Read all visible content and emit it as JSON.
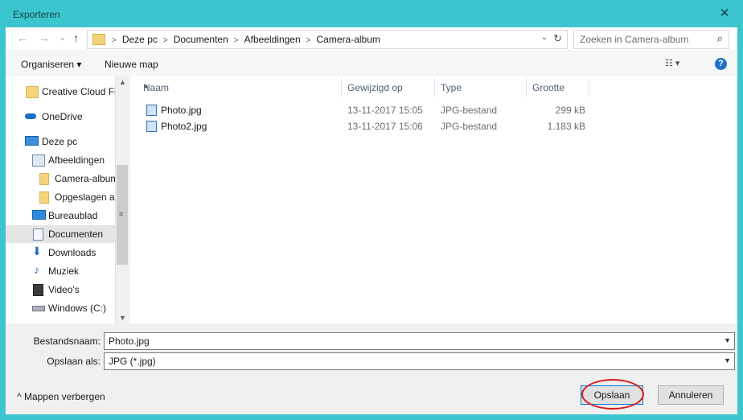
{
  "window": {
    "title": "Exporteren",
    "close_glyph": "✕"
  },
  "nav_buttons": {
    "back": "←",
    "forward": "→",
    "recent": "⌄",
    "up": "↑"
  },
  "address": {
    "crumbs": [
      "Deze pc",
      "Documenten",
      "Afbeeldingen",
      "Camera-album"
    ],
    "dropdown_glyph": "⌄",
    "refresh_glyph": "↻"
  },
  "search": {
    "placeholder": "Zoeken in Camera-album",
    "icon": "search-icon"
  },
  "toolbar": {
    "organize": "Organiseren ▾",
    "new_folder": "Nieuwe map",
    "view_glyph": "☷ ▾",
    "help_glyph": "?"
  },
  "nav": {
    "items": [
      {
        "label": "Creative Cloud Fil",
        "icon": "creative-cloud-icon"
      },
      {
        "label": "OneDrive",
        "icon": "onedrive-icon"
      },
      {
        "label": "Deze pc",
        "icon": "computer-icon"
      },
      {
        "label": "Afbeeldingen",
        "icon": "pictures-icon"
      },
      {
        "label": "Camera-album",
        "icon": "folder-icon"
      },
      {
        "label": "Opgeslagen afl",
        "icon": "folder-icon"
      },
      {
        "label": "Bureaublad",
        "icon": "desktop-icon"
      },
      {
        "label": "Documenten",
        "icon": "documents-icon"
      },
      {
        "label": "Downloads",
        "icon": "downloads-icon"
      },
      {
        "label": "Muziek",
        "icon": "music-icon"
      },
      {
        "label": "Video's",
        "icon": "videos-icon"
      },
      {
        "label": "Windows  (C:)",
        "icon": "drive-icon"
      }
    ],
    "selected": "Documenten"
  },
  "files": {
    "columns": [
      "Naam",
      "Gewijzigd op",
      "Type",
      "Grootte"
    ],
    "rows": [
      {
        "name": "Photo.jpg",
        "modified": "13-11-2017 15:05",
        "type": "JPG-bestand",
        "size": "299 kB"
      },
      {
        "name": "Photo2.jpg",
        "modified": "13-11-2017 15:06",
        "type": "JPG-bestand",
        "size": "1.183 kB"
      }
    ]
  },
  "form": {
    "filename_label": "Bestandsnaam:",
    "filename_value": "Photo.jpg",
    "savetype_label": "Opslaan als:",
    "savetype_value": "JPG (*.jpg)"
  },
  "footer": {
    "hide_folders": "^  Mappen verbergen",
    "save": "Opslaan",
    "cancel": "Annuleren"
  },
  "colors": {
    "titlebar": "#3bc6cf",
    "highlight_ring": "#d91a1a",
    "primary_border": "#0078d7"
  }
}
